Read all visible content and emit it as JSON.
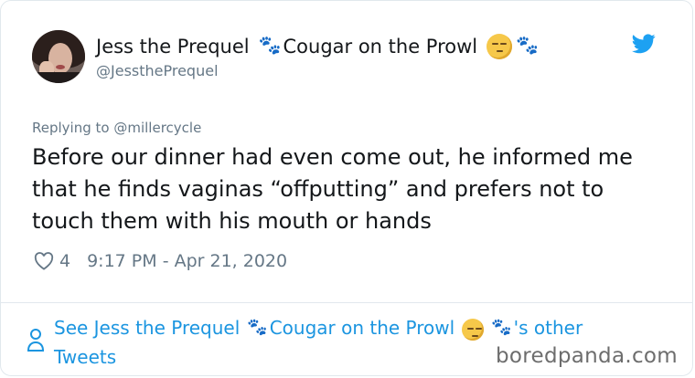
{
  "author": {
    "name": "Jess the Prequel",
    "name_suffix": "Cougar on the Prowl",
    "handle": "@JessthePrequel"
  },
  "tweet": {
    "reply_prefix": "Replying to",
    "reply_to": "@millercycle",
    "text": "Before our dinner had even come out, he informed me that he finds vaginas “offputting” and prefers not to touch them with his mouth or hands",
    "likes": "4",
    "timestamp": "9:17 PM - Apr 21, 2020"
  },
  "footer": {
    "prefix": "See Jess the Prequel",
    "name_suffix": "Cougar on the Prowl",
    "suffix": "'s other Tweets"
  },
  "watermark": "boredpanda.com",
  "icons": {
    "bird": "twitter-bird-icon",
    "heart": "heart-icon",
    "user": "user-icon",
    "paw": "paw-icon",
    "smirk": "smirk-emoji-icon"
  },
  "colors": {
    "link": "#1b95e0",
    "muted": "#657786",
    "text": "#14171a"
  }
}
